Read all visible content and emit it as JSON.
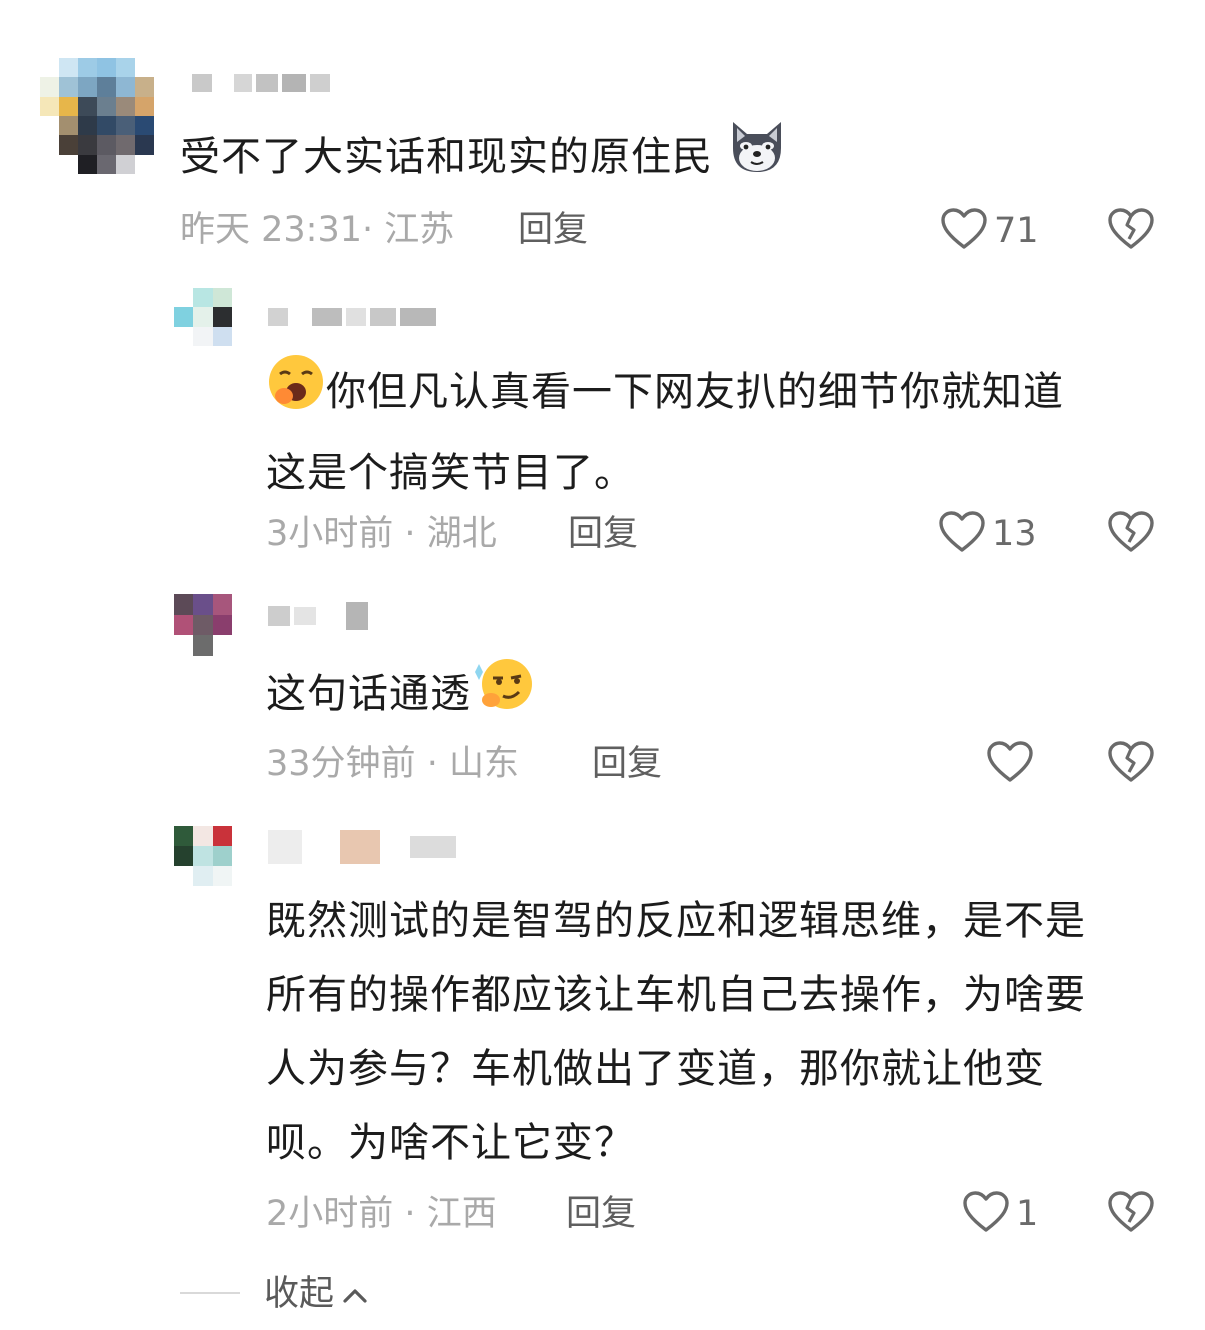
{
  "comments": [
    {
      "text_lines": [
        "受不了大实话和现实的原住民"
      ],
      "emoji": "wolf-emoji",
      "time": "昨天 23:31",
      "sep": "·",
      "location": "江苏",
      "reply_label": "回复",
      "likes": "71"
    },
    {
      "text_lines": [
        "你但凡认真看一下网友扒的细节你就知道",
        "这是个搞笑节目了。"
      ],
      "emoji": "yawning-face-emoji",
      "time": "3小时前",
      "sep": "·",
      "location": "湖北",
      "reply_label": "回复",
      "likes": "13"
    },
    {
      "text_lines": [
        "这句话通透"
      ],
      "emoji": "smirking-thinking-emoji",
      "time": "33分钟前",
      "sep": "·",
      "location": "山东",
      "reply_label": "回复",
      "likes": ""
    },
    {
      "text_lines": [
        "既然测试的是智驾的反应和逻辑思维，是不是",
        "所有的操作都应该让车机自己去操作，为啥要",
        "人为参与？车机做出了变道，那你就让他变",
        "呗。为啥不让它变？"
      ],
      "time": "2小时前",
      "sep": "·",
      "location": "江西",
      "reply_label": "回复",
      "likes": "1"
    }
  ],
  "collapse_label": "收起",
  "colors": {
    "meta": "#a9a9a9",
    "text": "#1c1c1c",
    "icon": "#6a6a6a"
  }
}
